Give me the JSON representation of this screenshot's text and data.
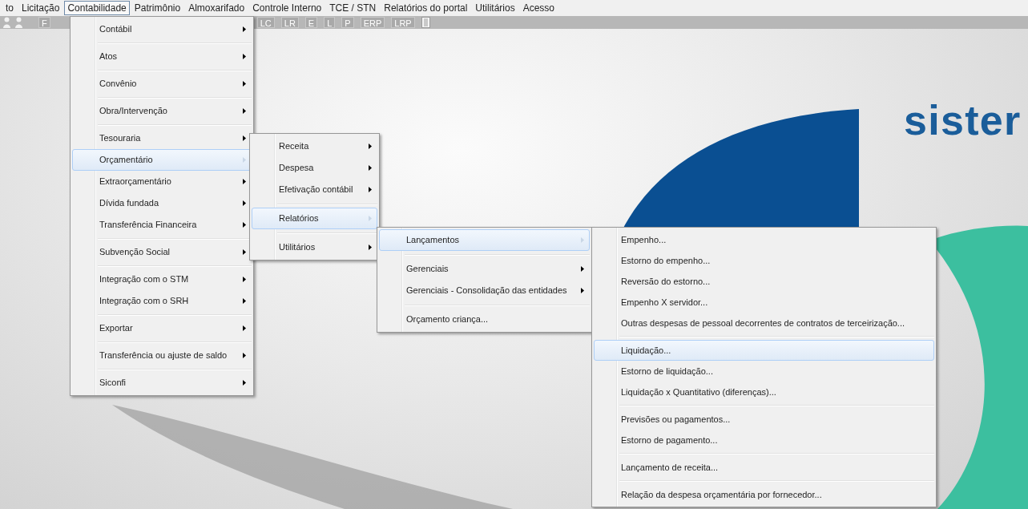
{
  "menu_bar": [
    {
      "label": "to",
      "selected": false
    },
    {
      "label": "Licitação",
      "selected": false
    },
    {
      "label": "Contabilidade",
      "selected": true
    },
    {
      "label": "Patrimônio",
      "selected": false
    },
    {
      "label": "Almoxarifado",
      "selected": false
    },
    {
      "label": "Controle Interno",
      "selected": false
    },
    {
      "label": "TCE / STN",
      "selected": false
    },
    {
      "label": "Relatórios do portal",
      "selected": false
    },
    {
      "label": "Utilitários",
      "selected": false
    },
    {
      "label": "Acesso",
      "selected": false
    }
  ],
  "toolbar": {
    "left": [
      {
        "kind": "person"
      },
      {
        "kind": "person"
      },
      {
        "kind": "text",
        "label": "F"
      }
    ],
    "right": [
      {
        "kind": "text",
        "label": "LC"
      },
      {
        "kind": "text",
        "label": "LR"
      },
      {
        "kind": "text",
        "label": "E"
      },
      {
        "kind": "text",
        "label": "L"
      },
      {
        "kind": "text",
        "label": "P"
      },
      {
        "kind": "text",
        "label": "ERP"
      },
      {
        "kind": "text",
        "label": "LRP"
      },
      {
        "kind": "door"
      }
    ]
  },
  "logo_text": "sister",
  "menus": [
    {
      "items": [
        {
          "kind": "item",
          "label": "Contábil",
          "has_submenu": true,
          "selected": false
        },
        {
          "kind": "separator"
        },
        {
          "kind": "item",
          "label": "Atos",
          "has_submenu": true,
          "selected": false
        },
        {
          "kind": "separator"
        },
        {
          "kind": "item",
          "label": "Convênio",
          "has_submenu": true,
          "selected": false
        },
        {
          "kind": "separator"
        },
        {
          "kind": "item",
          "label": "Obra/Intervenção",
          "has_submenu": true,
          "selected": false
        },
        {
          "kind": "separator"
        },
        {
          "kind": "item",
          "label": "Tesouraria",
          "has_submenu": true,
          "selected": false
        },
        {
          "kind": "item",
          "label": "Orçamentário",
          "has_submenu": true,
          "selected": true
        },
        {
          "kind": "item",
          "label": "Extraorçamentário",
          "has_submenu": true,
          "selected": false
        },
        {
          "kind": "item",
          "label": "Dívida fundada",
          "has_submenu": true,
          "selected": false
        },
        {
          "kind": "item",
          "label": "Transferência Financeira",
          "has_submenu": true,
          "selected": false
        },
        {
          "kind": "separator"
        },
        {
          "kind": "item",
          "label": "Subvenção Social",
          "has_submenu": true,
          "selected": false
        },
        {
          "kind": "separator"
        },
        {
          "kind": "item",
          "label": "Integração com o STM",
          "has_submenu": true,
          "selected": false
        },
        {
          "kind": "item",
          "label": "Integração com o SRH",
          "has_submenu": true,
          "selected": false
        },
        {
          "kind": "separator"
        },
        {
          "kind": "item",
          "label": "Exportar",
          "has_submenu": true,
          "selected": false
        },
        {
          "kind": "separator"
        },
        {
          "kind": "item",
          "label": "Transferência ou ajuste de saldo",
          "has_submenu": true,
          "selected": false
        },
        {
          "kind": "separator"
        },
        {
          "kind": "item",
          "label": "Siconfi",
          "has_submenu": true,
          "selected": false
        }
      ]
    },
    {
      "items": [
        {
          "kind": "item",
          "label": "Receita",
          "has_submenu": true,
          "selected": false
        },
        {
          "kind": "item",
          "label": "Despesa",
          "has_submenu": true,
          "selected": false
        },
        {
          "kind": "item",
          "label": "Efetivação contábil",
          "has_submenu": true,
          "selected": false
        },
        {
          "kind": "separator"
        },
        {
          "kind": "item",
          "label": "Relatórios",
          "has_submenu": true,
          "selected": true
        },
        {
          "kind": "separator"
        },
        {
          "kind": "item",
          "label": "Utilitários",
          "has_submenu": true,
          "selected": false
        }
      ]
    },
    {
      "items": [
        {
          "kind": "item",
          "label": "Lançamentos",
          "has_submenu": true,
          "selected": true
        },
        {
          "kind": "separator"
        },
        {
          "kind": "item",
          "label": "Gerenciais",
          "has_submenu": true,
          "selected": false
        },
        {
          "kind": "item",
          "label": "Gerenciais - Consolidação das entidades",
          "has_submenu": true,
          "selected": false
        },
        {
          "kind": "separator"
        },
        {
          "kind": "item",
          "label": "Orçamento criança...",
          "has_submenu": false,
          "selected": false
        }
      ]
    },
    {
      "items": [
        {
          "kind": "item",
          "label": "Empenho...",
          "has_submenu": false,
          "selected": false
        },
        {
          "kind": "item",
          "label": "Estorno do empenho...",
          "has_submenu": false,
          "selected": false
        },
        {
          "kind": "item",
          "label": "Reversão do estorno...",
          "has_submenu": false,
          "selected": false
        },
        {
          "kind": "item",
          "label": "Empenho X servidor...",
          "has_submenu": false,
          "selected": false
        },
        {
          "kind": "item",
          "label": "Outras despesas de pessoal decorrentes de contratos de terceirização...",
          "has_submenu": false,
          "selected": false
        },
        {
          "kind": "separator"
        },
        {
          "kind": "item",
          "label": "Liquidação...",
          "has_submenu": false,
          "selected": true
        },
        {
          "kind": "item",
          "label": "Estorno de liquidação...",
          "has_submenu": false,
          "selected": false
        },
        {
          "kind": "item",
          "label": "Liquidação x Quantitativo (diferenças)...",
          "has_submenu": false,
          "selected": false
        },
        {
          "kind": "separator"
        },
        {
          "kind": "item",
          "label": "Previsões ou pagamentos...",
          "has_submenu": false,
          "selected": false
        },
        {
          "kind": "item",
          "label": "Estorno de pagamento...",
          "has_submenu": false,
          "selected": false
        },
        {
          "kind": "separator"
        },
        {
          "kind": "item",
          "label": "Lançamento de receita...",
          "has_submenu": false,
          "selected": false
        },
        {
          "kind": "separator"
        },
        {
          "kind": "item",
          "label": "Relação da despesa orçamentária por fornecedor...",
          "has_submenu": false,
          "selected": false
        }
      ]
    }
  ]
}
